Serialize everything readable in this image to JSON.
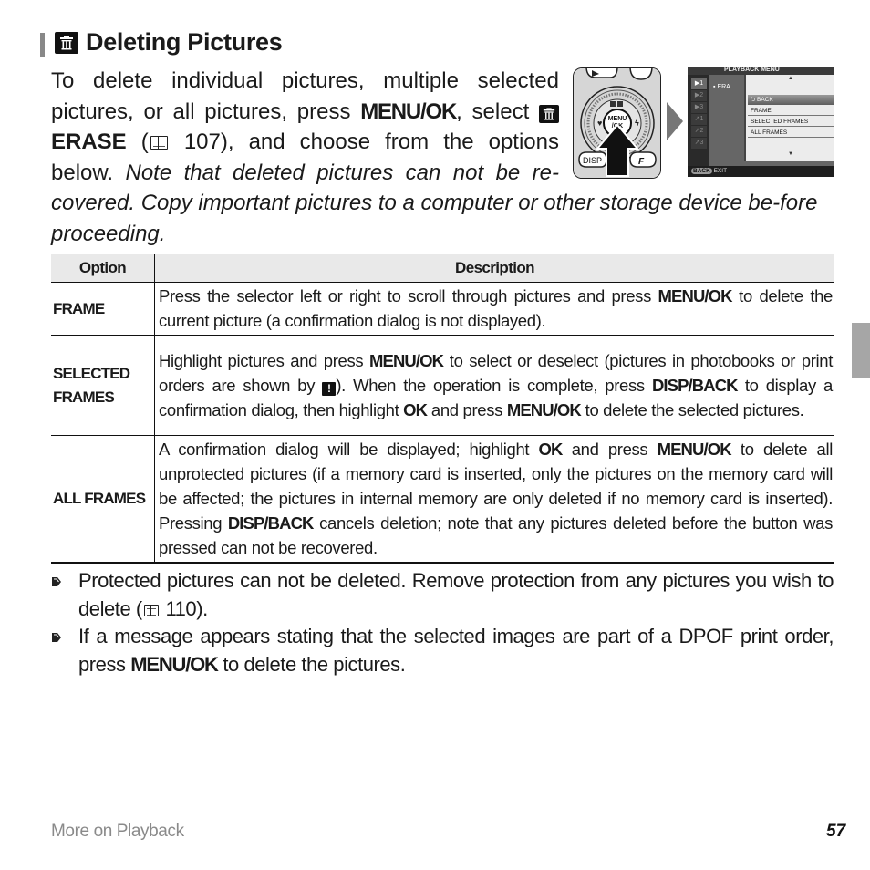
{
  "heading": {
    "title": "Deleting Pictures",
    "icon": "trash-icon"
  },
  "intro": {
    "part1": "To delete individual pictures, multiple selected pictures, or all pictures, press ",
    "menu_ok": "MENU/OK",
    "part2": ", select ",
    "erase_label": "ERASE",
    "part3": " (",
    "page_ref": "107",
    "part4": "), and choose from the options below.  ",
    "italic1": "Note that deleted pictures can not be re-",
    "italic2": "covered.  Copy important pictures to a computer or other storage device be-fore proceeding."
  },
  "illustration": {
    "camera": {
      "center_button": "MENU\n/OK",
      "disp_label": "DISP",
      "f_label": "F"
    },
    "screen": {
      "title": "PLAYBACK MENU",
      "tabs": [
        "▶1",
        "▶2",
        "▶3",
        "↗1",
        "↗2",
        "↗3"
      ],
      "active_tab": 0,
      "current_item": "ERA",
      "submenu": [
        "BACK",
        "FRAME",
        "SELECTED FRAMES",
        "ALL FRAMES"
      ],
      "highlighted": "BACK",
      "bottom_back": "BACK",
      "bottom_exit": "EXIT"
    }
  },
  "table": {
    "headers": [
      "Option",
      "Description"
    ],
    "rows": [
      {
        "option": "FRAME",
        "segments": [
          {
            "t": "Press the selector left or right to scroll through pictures and press "
          },
          {
            "b": "MENU/OK"
          },
          {
            "t": " to delete the current picture (a confirmation dialog is not displayed)."
          }
        ]
      },
      {
        "option": "SELECTED FRAMES",
        "segments": [
          {
            "t": "Highlight pictures and press "
          },
          {
            "b": "MENU/OK"
          },
          {
            "t": " to select or deselect (pictures in photobooks or print orders are shown by "
          },
          {
            "icon": "!"
          },
          {
            "t": ").  When the operation is complete, press "
          },
          {
            "b": "DISP/BACK"
          },
          {
            "t": " to display a confirmation dialog, then highlight "
          },
          {
            "b": "OK"
          },
          {
            "t": " and press "
          },
          {
            "b": "MENU/OK"
          },
          {
            "t": " to delete the selected pictures."
          }
        ]
      },
      {
        "option": "ALL FRAMES",
        "segments": [
          {
            "t": "A confirmation dialog will be displayed; highlight "
          },
          {
            "b": "OK"
          },
          {
            "t": " and press "
          },
          {
            "b": "MENU/OK"
          },
          {
            "t": " to delete all unprotected pictures (if a memory card is inserted, only the pictures on the memory card will be affected; the pictures in internal memory are only deleted if no memory card is inserted).  Pressing "
          },
          {
            "b": "DISP/BACK"
          },
          {
            "t": " cancels deletion; note that any pictures deleted before the button was pressed can not be recovered."
          }
        ]
      }
    ]
  },
  "notes": [
    {
      "text1": "Protected pictures can not be deleted.  Remove protection from any pictures you wish to delete (",
      "page_ref": "110",
      "text2": ")."
    },
    {
      "text1": "If a message appears stating that the selected images are part of a DPOF print order, press ",
      "bold": "MENU/OK",
      "text2": " to delete the pictures."
    }
  ],
  "footer": {
    "section": "More on Playback",
    "page_number": "57"
  }
}
